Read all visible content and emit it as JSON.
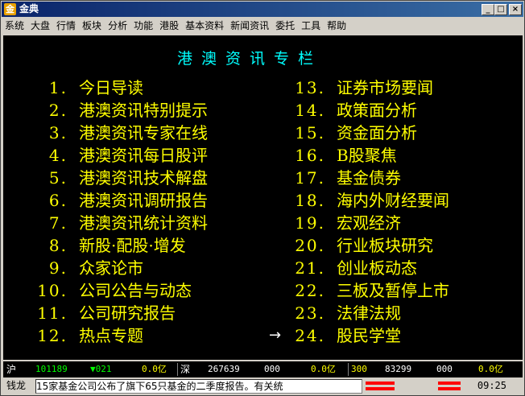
{
  "window": {
    "title": "金典",
    "app_icon": "金"
  },
  "menu": [
    "系统",
    "大盘",
    "行情",
    "板块",
    "分析",
    "功能",
    "港股",
    "基本资料",
    "新闻资讯",
    "委托",
    "工具",
    "帮助"
  ],
  "heading": "港澳资讯专栏",
  "left_items": [
    {
      "num": "1.",
      "label": "今日导读"
    },
    {
      "num": "2.",
      "label": "港澳资讯特别提示"
    },
    {
      "num": "3.",
      "label": "港澳资讯专家在线"
    },
    {
      "num": "4.",
      "label": "港澳资讯每日股评"
    },
    {
      "num": "5.",
      "label": "港澳资讯技术解盘"
    },
    {
      "num": "6.",
      "label": "港澳资讯调研报告"
    },
    {
      "num": "7.",
      "label": "港澳资讯统计资料"
    },
    {
      "num": "8.",
      "label": "新股·配股·增发"
    },
    {
      "num": "9.",
      "label": "众家论市"
    },
    {
      "num": "10.",
      "label": "公司公告与动态"
    },
    {
      "num": "11.",
      "label": "公司研究报告"
    },
    {
      "num": "12.",
      "label": "热点专题"
    }
  ],
  "right_items": [
    {
      "num": "13.",
      "label": "证券市场要闻"
    },
    {
      "num": "14.",
      "label": "政策面分析"
    },
    {
      "num": "15.",
      "label": "资金面分析"
    },
    {
      "num": "16.",
      "label": "B股聚焦"
    },
    {
      "num": "17.",
      "label": "基金债券"
    },
    {
      "num": "18.",
      "label": "海内外财经要闻"
    },
    {
      "num": "19.",
      "label": "宏观经济"
    },
    {
      "num": "20.",
      "label": "行业板块研究"
    },
    {
      "num": "21.",
      "label": "创业板动态"
    },
    {
      "num": "22.",
      "label": "三板及暂停上市"
    },
    {
      "num": "23.",
      "label": "法律法规"
    },
    {
      "num": "24.",
      "label": "股民学堂"
    }
  ],
  "arrow": "→",
  "status": {
    "sh_label": "沪",
    "sh_value": "101189",
    "sh_change": "▼021",
    "sh_amount": "0.0亿",
    "sz_label": "深",
    "sz_value": "267639",
    "sz_change": "000",
    "sz_amount": "0.0亿",
    "idx300_label": "300",
    "idx300_value": "83299",
    "idx300_change": "000",
    "idx300_amount": "0.0亿"
  },
  "ticker": {
    "label": "钱龙",
    "text": "15家基金公司公布了旗下65只基金的二季度报告。有关统",
    "time": "09:25"
  }
}
